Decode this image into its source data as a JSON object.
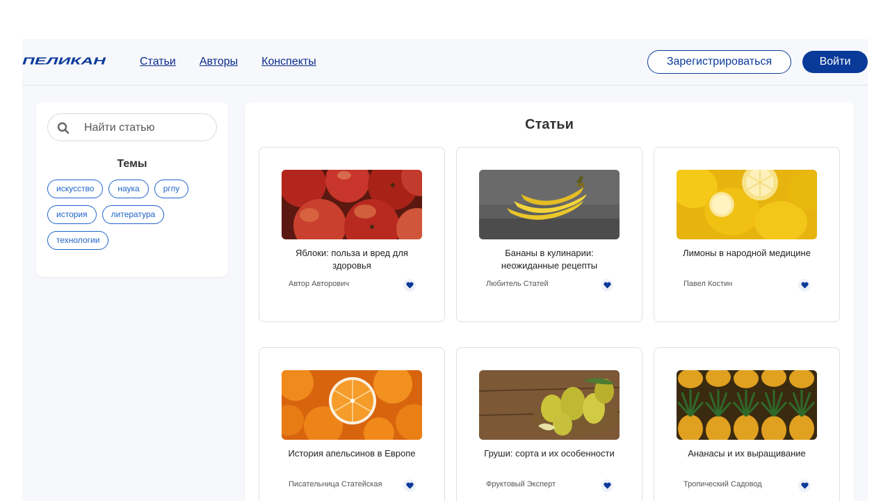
{
  "header": {
    "logo_text": "ПЕЛИКАН",
    "nav": [
      {
        "label": "Статьи"
      },
      {
        "label": "Авторы"
      },
      {
        "label": "Конспекты"
      }
    ],
    "register_label": "Зарегистрироваться",
    "login_label": "Войти"
  },
  "sidebar": {
    "search": {
      "placeholder": "Найти статью",
      "value": "",
      "icon": "search-icon"
    },
    "topics_title": "Темы",
    "tags": [
      "искусство",
      "наука",
      "ргпу",
      "история",
      "литература",
      "технологии"
    ]
  },
  "main": {
    "title": "Статьи",
    "articles": [
      {
        "title": "Яблоки: польза и вред для здоровья",
        "author": "Автор Авторович",
        "image": "apples-photo"
      },
      {
        "title": "Бананы в кулинарии: неожиданные рецепты",
        "author": "Любитель Статей",
        "image": "bananas-photo"
      },
      {
        "title": "Лимоны в народной медицине",
        "author": "Павел Костин",
        "image": "lemons-photo"
      },
      {
        "title": "История апельсинов в Европе",
        "author": "Писательница Статейская",
        "image": "oranges-photo"
      },
      {
        "title": "Груши: сорта и их особенности",
        "author": "Фруктовый Эксперт",
        "image": "pears-photo"
      },
      {
        "title": "Ананасы и их выращивание",
        "author": "Тропический Садовод",
        "image": "pineapples-photo"
      }
    ]
  },
  "colors": {
    "brand": "#0a3a99",
    "link": "#0a2a8a",
    "tag": "#1e63c9",
    "background": "#f7f8fc"
  }
}
